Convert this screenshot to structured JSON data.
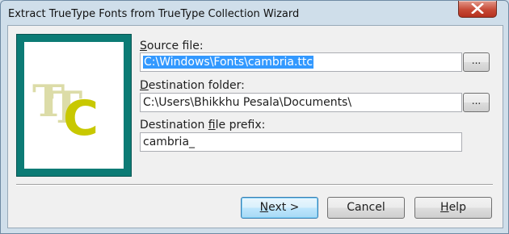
{
  "window": {
    "title": "Extract TrueType Fonts from TrueType Collection Wizard"
  },
  "colors": {
    "image_frame": "#0c7b75",
    "logo": "#c8c800",
    "logo_shadow": "#d8d8a8",
    "selection": "#3399ff"
  },
  "form": {
    "source": {
      "label_accel": "S",
      "label_rest": "ource file:",
      "value": "C:\\Windows\\Fonts\\cambria.ttc",
      "browse": "..."
    },
    "destination": {
      "label_accel": "D",
      "label_rest": "estination folder:",
      "value": "C:\\Users\\Bhikkhu Pesala\\Documents\\",
      "browse": "..."
    },
    "prefix": {
      "label_pre": "Destination ",
      "label_accel": "f",
      "label_rest": "ile prefix:",
      "value": "cambria_"
    }
  },
  "buttons": {
    "next": {
      "accel": "N",
      "rest": "ext >"
    },
    "cancel": {
      "label": "Cancel"
    },
    "help": {
      "accel": "H",
      "rest": "elp"
    }
  },
  "logo": {
    "letters": [
      "T",
      "T",
      "C"
    ]
  }
}
